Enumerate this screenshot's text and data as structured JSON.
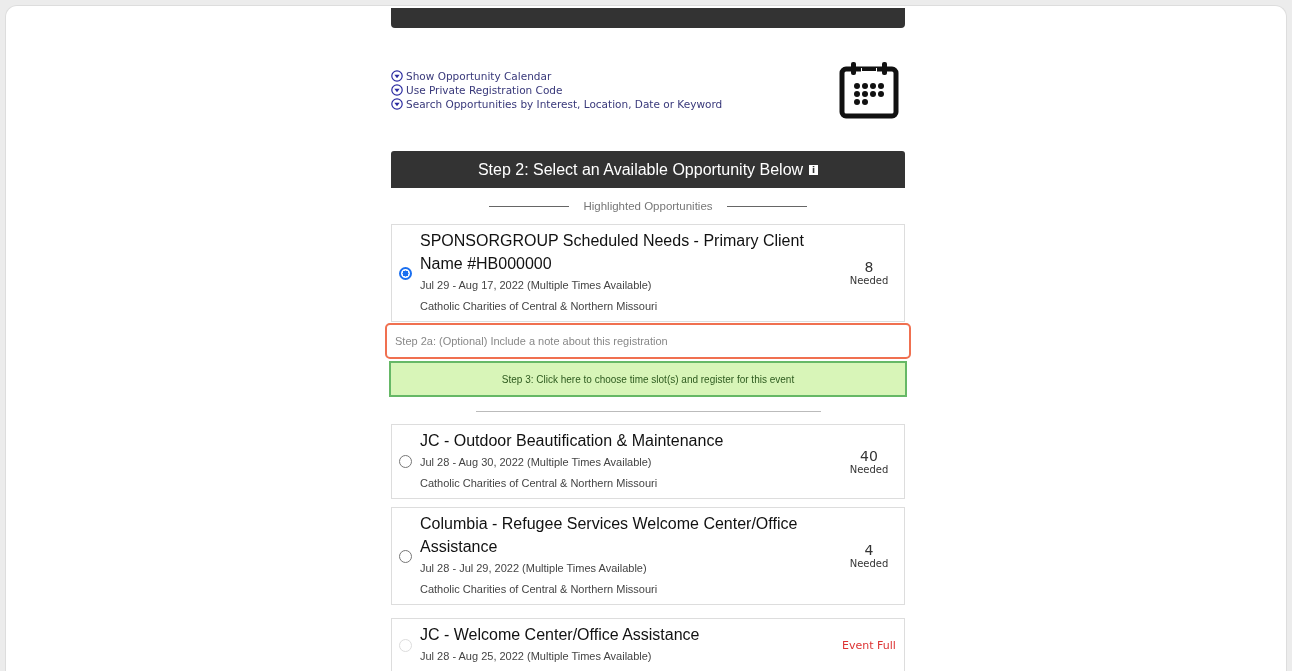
{
  "links": [
    {
      "label": "Show Opportunity Calendar"
    },
    {
      "label": "Use Private Registration Code"
    },
    {
      "label": "Search Opportunities by Interest, Location, Date or Keyword"
    }
  ],
  "step2": {
    "title": "Step 2: Select an Available Opportunity Below",
    "info": "i"
  },
  "highlighted_label": "Highlighted Opportunities",
  "featured": {
    "title": "SPONSORGROUP Scheduled Needs - Primary Client Name #HB000000",
    "dates": "Jul 29 - Aug 17, 2022 (Multiple Times Available)",
    "org": "Catholic Charities of Central & Northern Missouri",
    "kind": "needed",
    "count": "8",
    "count_label": "Needed",
    "selected": true,
    "disabled": false
  },
  "note_field": {
    "placeholder": "Step 2a: (Optional) Include a note about this registration"
  },
  "step3_button": "Step 3: Click here to choose time slot(s) and register for this event",
  "opportunities": [
    {
      "title": "JC - Outdoor Beautification & Maintenance",
      "dates": "Jul 28 - Aug 30, 2022 (Multiple Times Available)",
      "org": "Catholic Charities of Central & Northern Missouri",
      "kind": "needed",
      "count": "40",
      "count_label": "Needed",
      "selected": false,
      "disabled": false
    },
    {
      "title": "Columbia - Refugee Services Welcome Center/Office Assistance",
      "dates": "Jul 28 - Jul 29, 2022 (Multiple Times Available)",
      "org": "Catholic Charities of Central & Northern Missouri",
      "kind": "needed",
      "count": "4",
      "count_label": "Needed",
      "selected": false,
      "disabled": false
    },
    {
      "title": "JC - Welcome Center/Office Assistance",
      "dates": "Jul 28 - Aug 25, 2022 (Multiple Times Available)",
      "kind": "full",
      "status": "Event Full",
      "selected": false,
      "disabled": true
    }
  ]
}
